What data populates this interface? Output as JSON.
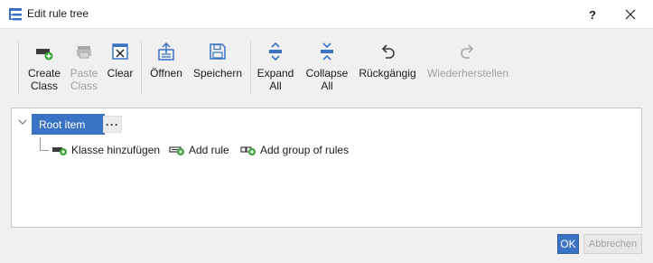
{
  "window": {
    "title": "Edit rule tree",
    "help_label": "?",
    "close_label": "✕",
    "icon": "rule-tree-icon"
  },
  "toolbar": {
    "create_class": [
      "Create",
      "Class"
    ],
    "paste_class": [
      "Paste",
      "Class"
    ],
    "clear": "Clear",
    "open": "Öffnen",
    "save": "Speichern",
    "expand_all": [
      "Expand",
      "All"
    ],
    "collapse_all": [
      "Collapse",
      "All"
    ],
    "undo": "Rückgängig",
    "redo": "Wiederherstellen"
  },
  "tree": {
    "root_label": "Root item",
    "more_label": "···",
    "actions": {
      "add_class": "Klasse hinzufügen",
      "add_rule": "Add rule",
      "add_group": "Add group of rules"
    }
  },
  "footer": {
    "ok": "OK",
    "cancel": "Abbrechen"
  },
  "colors": {
    "accent": "#3a73c4",
    "add_green": "#3ea43a",
    "disabled_text": "#a0a0a0"
  }
}
